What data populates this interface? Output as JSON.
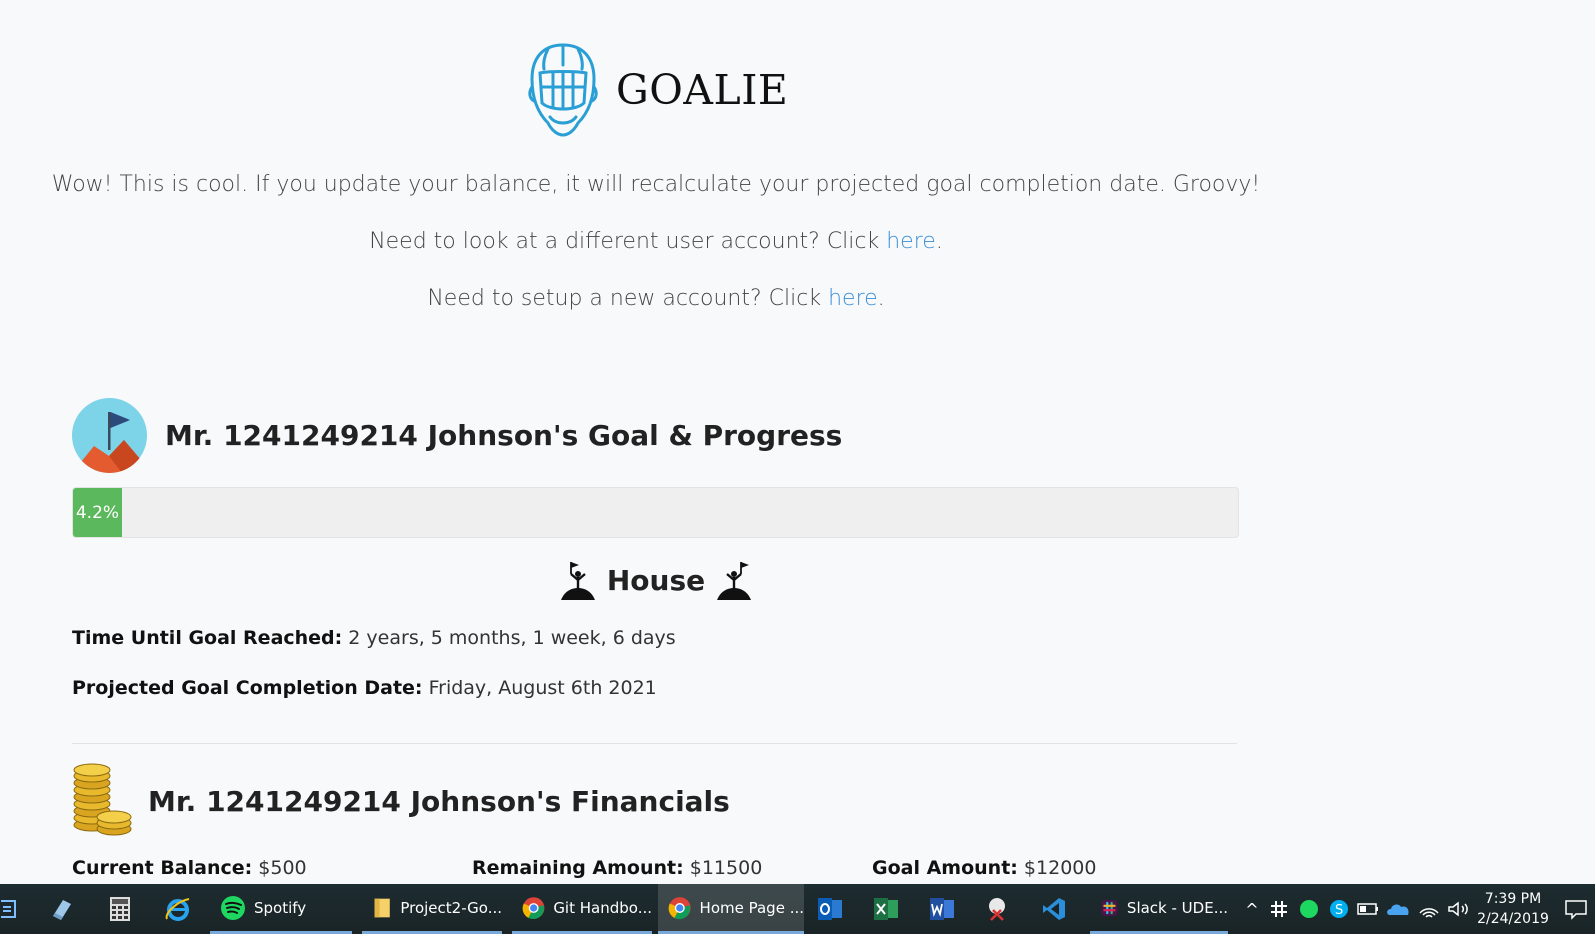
{
  "logo": {
    "text": "GOALIE",
    "icon": "goalie-mask-icon"
  },
  "intro": {
    "line1": "Wow! This is cool. If you update your balance, it will recalculate your projected goal completion date. Groovy!",
    "line2_prefix": "Need to look at a different user account? Click ",
    "line2_link": "here",
    "line2_suffix": ".",
    "line3_prefix": "Need to setup a new account? Click ",
    "line3_link": "here",
    "line3_suffix": "."
  },
  "goal_section": {
    "icon": "mountain-flag-icon",
    "title": "Mr. 1241249214 Johnson's Goal & Progress",
    "progress_percent": 4.2,
    "progress_label": "4.2%",
    "goal_name": "House",
    "time_label": "Time Until Goal Reached:",
    "time_value": " 2 years, 5 months, 1 week, 6 days",
    "date_label": "Projected Goal Completion Date:",
    "date_value": " Friday, August 6th 2021"
  },
  "financials": {
    "icon": "coins-icon",
    "title": "Mr. 1241249214 Johnson's Financials",
    "balance_label": "Current Balance:",
    "balance_value": " $500",
    "remaining_label": "Remaining Amount:",
    "remaining_value": " $11500",
    "goal_label": "Goal Amount:",
    "goal_value": " $12000"
  },
  "taskbar": {
    "apps": [
      {
        "label": "Spotify",
        "icon": "spotify-icon"
      },
      {
        "label": "Project2-Go...",
        "icon": "folder-icon"
      },
      {
        "label": "Git Handbo...",
        "icon": "chrome-icon"
      },
      {
        "label": "Home Page ...",
        "icon": "chrome-icon",
        "active": true
      },
      {
        "label": "Slack - UDE...",
        "icon": "slack-icon"
      }
    ],
    "time": "7:39 PM",
    "date": "2/24/2019"
  }
}
